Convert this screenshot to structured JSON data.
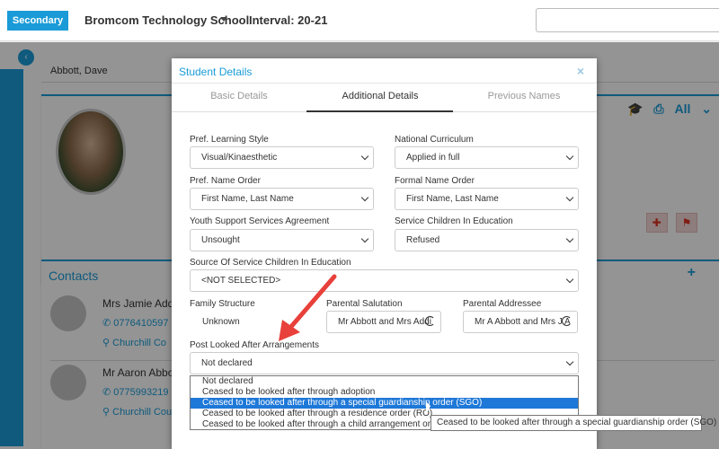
{
  "topbar": {
    "badge": "Secondary",
    "school": "Bromcom Technology School",
    "interval": "Interval: 20-21"
  },
  "background": {
    "student_name": "Abbott, Dave",
    "card_filter": "All",
    "contacts_title": "Contacts",
    "contacts": [
      {
        "name": "Mrs Jamie Addi",
        "phone": "0776410597",
        "address": "Churchill Co"
      },
      {
        "name": "Mr Aaron Abbot",
        "phone": "0775993219",
        "address": "Churchill Cou"
      }
    ]
  },
  "modal": {
    "title": "Student Details",
    "close_label": "×",
    "tabs": [
      "Basic Details",
      "Additional Details",
      "Previous Names"
    ],
    "active_tab": "Additional Details",
    "fields": {
      "pref_learning_style": {
        "label": "Pref. Learning Style",
        "value": "Visual/Kinaesthetic"
      },
      "national_curriculum": {
        "label": "National Curriculum",
        "value": "Applied in full"
      },
      "pref_name_order": {
        "label": "Pref. Name Order",
        "value": "First Name, Last Name"
      },
      "formal_name_order": {
        "label": "Formal Name Order",
        "value": "First Name, Last Name"
      },
      "youth_support": {
        "label": "Youth Support Services Agreement",
        "value": "Unsought"
      },
      "service_children": {
        "label": "Service Children In Education",
        "value": "Refused"
      },
      "source_service_children": {
        "label": "Source Of Service Children In Education",
        "value": "<NOT SELECTED>"
      },
      "family_structure": {
        "label": "Family Structure",
        "value": "Unknown"
      },
      "parental_salutation": {
        "label": "Parental Salutation",
        "value": "Mr Abbott and Mrs Addi"
      },
      "parental_addressee": {
        "label": "Parental Addressee",
        "value": "Mr A Abbott and Mrs J A"
      },
      "post_looked_after": {
        "label": "Post Looked After Arrangements",
        "value": "Not declared"
      }
    },
    "dropdown_options": [
      "Not declared",
      "Ceased to be looked after through adoption",
      "Ceased to be looked after through a special guardianship order (SGO)",
      "Ceased to be looked after through a residence order (RO)",
      "Ceased to be looked after through a child arrangement order"
    ],
    "highlighted_option_index": 2,
    "tooltip": "Ceased to be looked after through a special guardianship order (SGO)"
  },
  "colors": {
    "brand": "#1a9bd7",
    "selection": "#1e78d8",
    "annotation_arrow": "#e8403a"
  },
  "icons": {
    "back": "chevron-left-icon",
    "graduation": "graduation-cap-icon",
    "print": "printer-icon",
    "medical": "ambulance-icon",
    "flag": "flag-icon",
    "phone": "phone-icon",
    "location": "map-marker-icon",
    "refresh": "refresh-icon"
  }
}
